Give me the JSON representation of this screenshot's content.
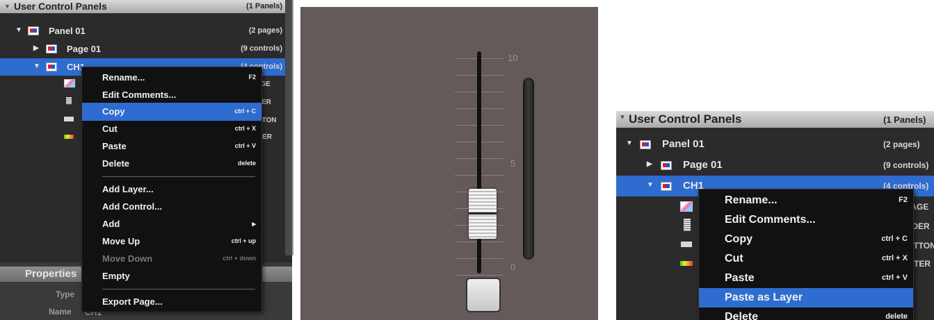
{
  "left": {
    "header": {
      "title": "User Control Panels",
      "count": "(1 Panels)"
    },
    "rows": [
      {
        "label": "Panel 01",
        "count": "(2 pages)"
      },
      {
        "label": "Page 01",
        "count": "(9 controls)"
      },
      {
        "label": "CH1",
        "count": "(4 controls)"
      }
    ],
    "children": [
      "IMAGE",
      "FADER",
      "BUTTON",
      "METER"
    ],
    "menu": [
      {
        "label": "Rename...",
        "shortcut": "F2"
      },
      {
        "label": "Edit Comments...",
        "shortcut": ""
      },
      {
        "label": "Copy",
        "shortcut": "ctrl + C"
      },
      {
        "label": "Cut",
        "shortcut": "ctrl + X"
      },
      {
        "label": "Paste",
        "shortcut": "ctrl + V"
      },
      {
        "label": "Delete",
        "shortcut": "delete"
      },
      {
        "label": "Add Layer...",
        "shortcut": ""
      },
      {
        "label": "Add Control...",
        "shortcut": ""
      },
      {
        "label": "Add",
        "shortcut": "▸"
      },
      {
        "label": "Move Up",
        "shortcut": "ctrl + up"
      },
      {
        "label": "Move Down",
        "shortcut": "ctrl + down"
      },
      {
        "label": "Empty",
        "shortcut": ""
      },
      {
        "label": "Export Page...",
        "shortcut": ""
      }
    ],
    "properties": {
      "title": "Properties",
      "type_label": "Type",
      "name_label": "Name",
      "name_value": "CH1"
    }
  },
  "fader": {
    "labels": [
      "10",
      "5",
      "0"
    ]
  },
  "right": {
    "header": {
      "title": "User Control Panels",
      "count": "(1 Panels)"
    },
    "rows": [
      {
        "label": "Panel 01",
        "count": "(2 pages)"
      },
      {
        "label": "Page 01",
        "count": "(9 controls)"
      },
      {
        "label": "CH1",
        "count": "(4 controls)"
      }
    ],
    "children": [
      "IMAGE",
      "FADER",
      "BUTTON",
      "METER"
    ],
    "menu": [
      {
        "label": "Rename...",
        "shortcut": "F2"
      },
      {
        "label": "Edit Comments...",
        "shortcut": ""
      },
      {
        "label": "Copy",
        "shortcut": "ctrl + C"
      },
      {
        "label": "Cut",
        "shortcut": "ctrl + X"
      },
      {
        "label": "Paste",
        "shortcut": "ctrl + V"
      },
      {
        "label": "Paste as Layer",
        "shortcut": ""
      },
      {
        "label": "Delete",
        "shortcut": "delete"
      }
    ]
  },
  "colors": {
    "selection": "#2e6cd0",
    "panel_bg": "#2b2b2b",
    "fader_bg": "#645a59"
  }
}
